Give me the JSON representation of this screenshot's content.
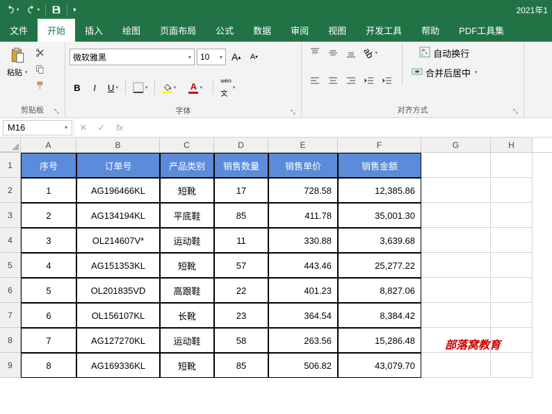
{
  "titlebar": {
    "right_text": "2021年1"
  },
  "tabs": {
    "file": "文件",
    "items": [
      "开始",
      "插入",
      "绘图",
      "页面布局",
      "公式",
      "数据",
      "审阅",
      "视图",
      "开发工具",
      "帮助",
      "PDF工具集"
    ],
    "active": "开始"
  },
  "ribbon": {
    "clipboard": {
      "paste": "粘贴",
      "label": "剪贴板"
    },
    "font": {
      "name": "微软雅黑",
      "size": "10",
      "label": "字体"
    },
    "alignment": {
      "wrap": "自动换行",
      "merge": "合并后居中",
      "label": "对齐方式"
    }
  },
  "formula": {
    "name_box": "M16",
    "fx": "fx"
  },
  "columns": [
    "A",
    "B",
    "C",
    "D",
    "E",
    "F",
    "G",
    "H"
  ],
  "headers": [
    "序号",
    "订单号",
    "产品类别",
    "销售数量",
    "销售单价",
    "销售金额"
  ],
  "rows": [
    {
      "n": "1",
      "id": "1",
      "order": "AG196466KL",
      "cat": "短靴",
      "qty": "17",
      "price": "728.58",
      "amount": "12,385.86"
    },
    {
      "n": "2",
      "id": "2",
      "order": "AG134194KL",
      "cat": "平底鞋",
      "qty": "85",
      "price": "411.78",
      "amount": "35,001.30"
    },
    {
      "n": "3",
      "id": "3",
      "order": "OL214607V*",
      "cat": "运动鞋",
      "qty": "11",
      "price": "330.88",
      "amount": "3,639.68"
    },
    {
      "n": "4",
      "id": "4",
      "order": "AG151353KL",
      "cat": "短靴",
      "qty": "57",
      "price": "443.46",
      "amount": "25,277.22"
    },
    {
      "n": "5",
      "id": "5",
      "order": "OL201835VD",
      "cat": "高跟鞋",
      "qty": "22",
      "price": "401.23",
      "amount": "8,827.06"
    },
    {
      "n": "6",
      "id": "6",
      "order": "OL156107KL",
      "cat": "长靴",
      "qty": "23",
      "price": "364.54",
      "amount": "8,384.42"
    },
    {
      "n": "7",
      "id": "7",
      "order": "AG127270KL",
      "cat": "运动鞋",
      "qty": "58",
      "price": "263.56",
      "amount": "15,286.48"
    },
    {
      "n": "8",
      "id": "8",
      "order": "AG169336KL",
      "cat": "短靴",
      "qty": "85",
      "price": "506.82",
      "amount": "43,079.70"
    }
  ],
  "watermark": "部落窝教育"
}
